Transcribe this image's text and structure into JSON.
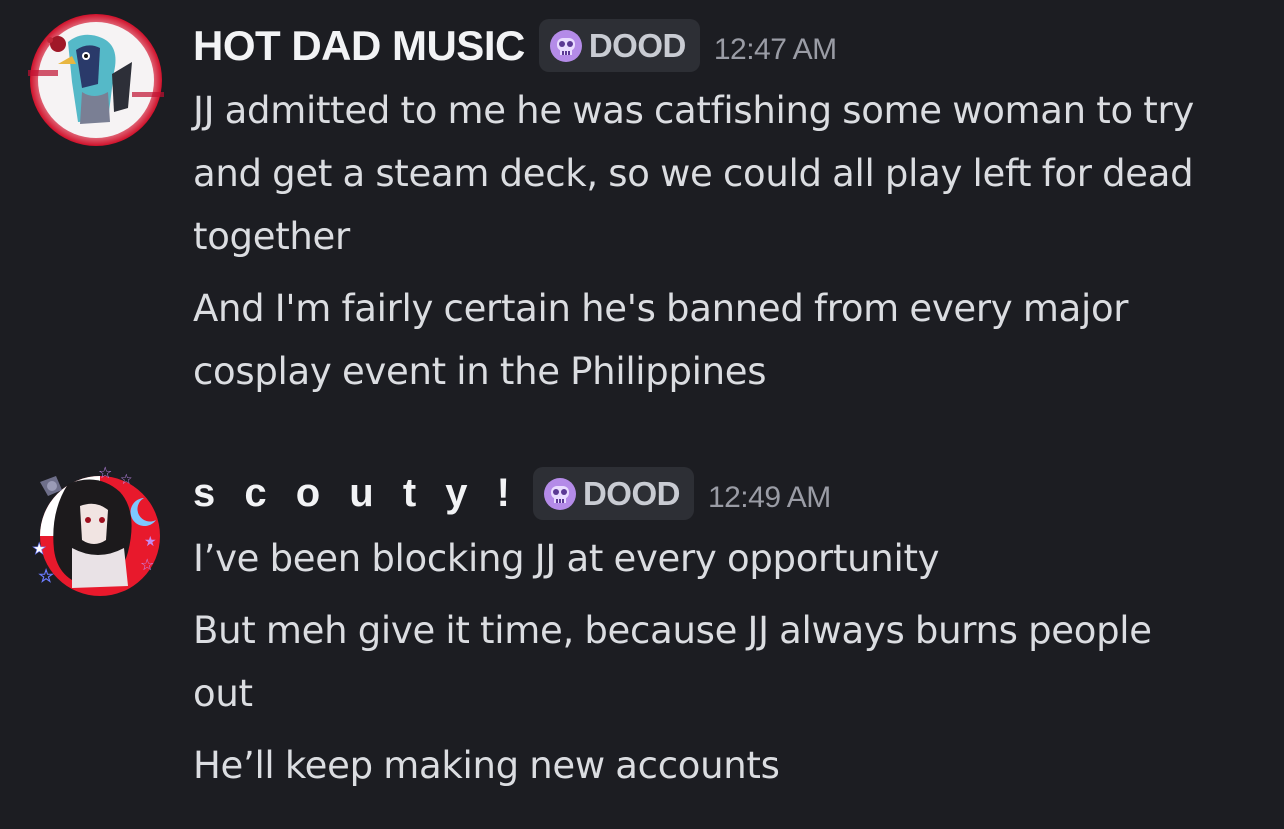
{
  "messages": [
    {
      "username": "HOT DAD MUSIC",
      "tag": "DOOD",
      "tag_icon": "skull-icon",
      "timestamp": "12:47 AM",
      "lines": [
        "JJ admitted to me he was catfishing some woman to try and get a steam deck, so we could all play left for dead together",
        "And I'm fairly certain he's banned from every major cosplay event in the Philippines"
      ]
    },
    {
      "username": "s c o u t y !",
      "tag": "DOOD",
      "tag_icon": "skull-icon",
      "timestamp": "12:49 AM",
      "lines": [
        "I’ve been blocking JJ at every opportunity",
        "But meh give it time, because JJ always burns people out",
        "He’ll keep making new accounts"
      ]
    }
  ],
  "colors": {
    "background": "#1c1d22",
    "username": "#f2f3f5",
    "message_text": "#dbdde1",
    "timestamp": "#9a9ca5",
    "tag_background": "#2d2f35",
    "skull": "#b48be8"
  }
}
